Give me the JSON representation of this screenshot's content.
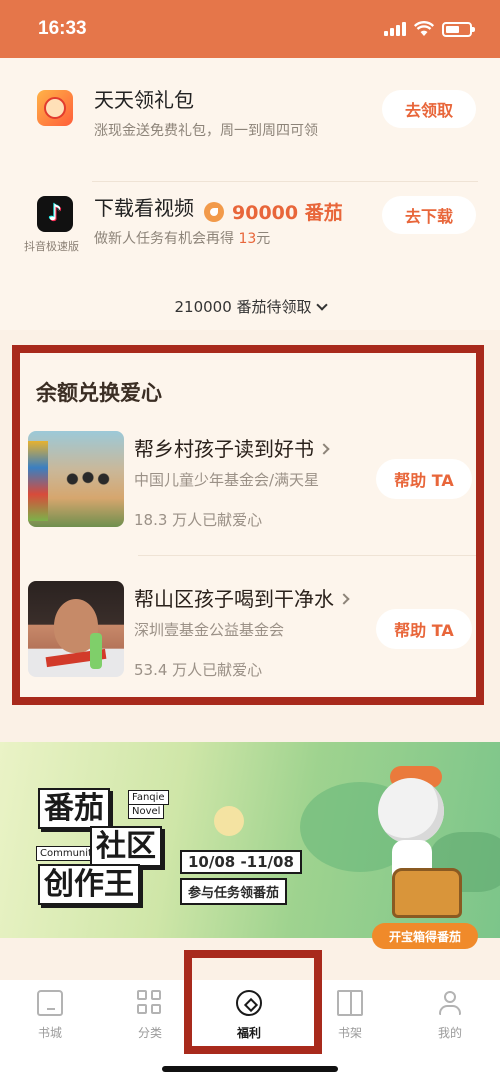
{
  "status_bar": {
    "time": "16:33",
    "battery_level": 0.4
  },
  "tasks": [
    {
      "title": "天天领礼包",
      "desc": "涨现金送免费礼包，周一到周四可领",
      "button": "去领取",
      "icon": "gift-app-icon"
    },
    {
      "title": "下载看视频",
      "reward": "90000 番茄",
      "desc_prefix": "做新人任务有机会再得",
      "desc_amount": "13",
      "desc_suffix": "元",
      "caption": "抖音极速版",
      "button": "去下载",
      "icon": "tiktok-icon"
    }
  ],
  "expand_more": "210000 番茄待领取",
  "charity": {
    "title": "余额兑换爱心",
    "items": [
      {
        "name": "帮乡村孩子读到好书",
        "org": "中国儿童少年基金会/满天星",
        "count": "18.3 万人已献爱心",
        "button": "帮助 TA"
      },
      {
        "name": "帮山区孩子喝到干净水",
        "org": "深圳壹基金公益基金会",
        "count": "53.4 万人已献爱心",
        "button": "帮助 TA"
      }
    ]
  },
  "banner": {
    "line1": "番茄",
    "line2": "社区",
    "line3": "创作王",
    "en1": "Fanqie",
    "en2": "Novel",
    "en3": "Community",
    "date": "10/08 -11/08",
    "task": "参与任务领番茄",
    "chest_button": "开宝箱得番茄"
  },
  "tabbar": [
    {
      "label": "书城",
      "icon": "bookstore-icon"
    },
    {
      "label": "分类",
      "icon": "category-grid-icon"
    },
    {
      "label": "福利",
      "icon": "welfare-icon",
      "active": true
    },
    {
      "label": "书架",
      "icon": "bookshelf-icon"
    },
    {
      "label": "我的",
      "icon": "profile-icon"
    }
  ],
  "colors": {
    "accent": "#e8663a",
    "status_bar": "#e5764a",
    "highlight_frame": "#a82a1c"
  }
}
